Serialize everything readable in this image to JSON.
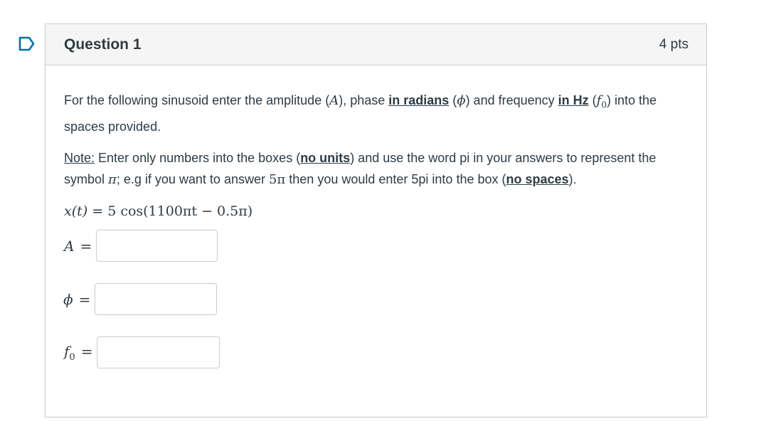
{
  "question": {
    "title": "Question 1",
    "points": "4 pts"
  },
  "prompt": {
    "p1_a": "For the following sinusoid enter the amplitude (",
    "p1_amp_sym": "A",
    "p1_b": "), phase ",
    "p1_radians": "in radians",
    "p1_c": " (",
    "p1_phase_sym": "ϕ",
    "p1_d": ") and frequency ",
    "p1_hz": "in Hz",
    "p1_e": " (",
    "p1_f0_sym": "f",
    "p1_f0_sub": "0",
    "p1_f": ") into the spaces provided.",
    "note_label": "Note:",
    "n_a": " Enter only numbers into the boxes (",
    "n_units": "no units",
    "n_b": ") and use the word pi in your answers to represent the symbol ",
    "n_pi": "π",
    "n_c": "; e.g if you want to answer ",
    "n_5pi": "5π",
    "n_d": " then you would enter 5pi into the box (",
    "n_spaces": "no spaces",
    "n_e": ")."
  },
  "equation": {
    "lhs": "x(t)",
    "eq": " = ",
    "rhs": "5 cos(1100πt − 0.5π)"
  },
  "fields": {
    "amplitude": {
      "symbol": "A",
      "eq": "=",
      "value": "",
      "placeholder": ""
    },
    "phase": {
      "symbol": "ϕ",
      "eq": "=",
      "value": "",
      "placeholder": ""
    },
    "frequency": {
      "symbol": "f",
      "sub": "0",
      "eq": "=",
      "value": "",
      "placeholder": ""
    }
  },
  "icons": {
    "flag": "bookmark-flag-icon"
  },
  "colors": {
    "text": "#2d3b45",
    "border": "#c7cdd1",
    "header_bg": "#f5f5f5",
    "flag": "#0770a3"
  }
}
